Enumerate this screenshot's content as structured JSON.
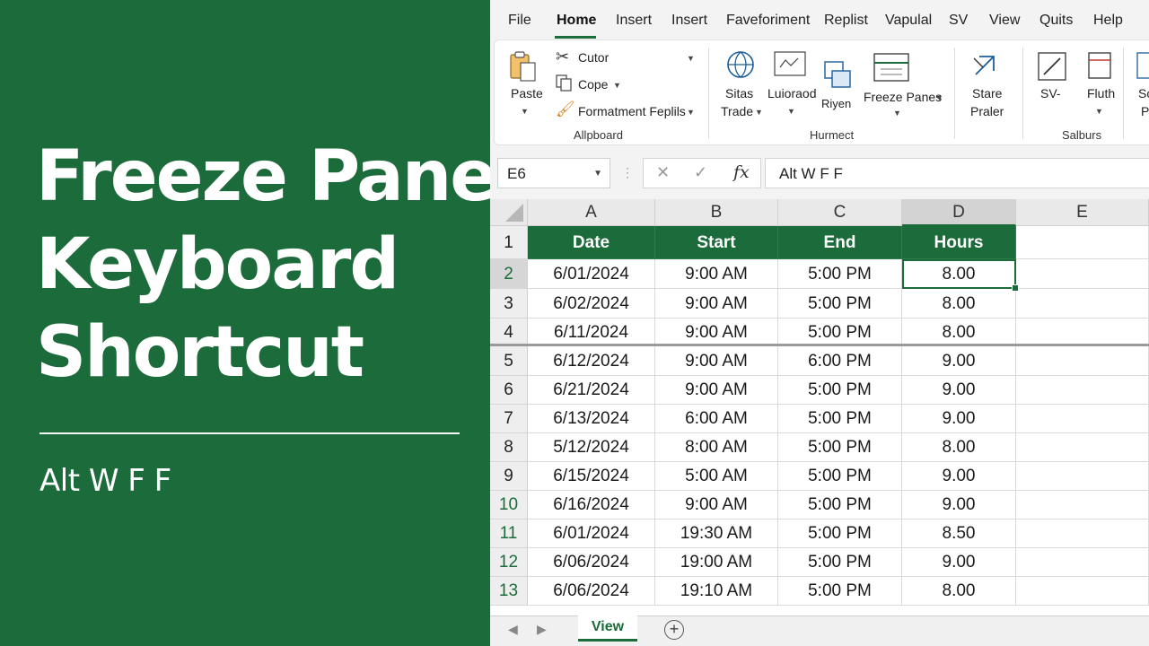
{
  "banner": {
    "title_lines": [
      "Freeze Panes",
      "Keyboard",
      "Shortcut"
    ],
    "shortcut": "Alt W F F"
  },
  "menu": {
    "items": [
      "File",
      "Home",
      "Insert",
      "Insert",
      "Faveforiment",
      "Replist",
      "Vapulal",
      "SV",
      "View",
      "Quits",
      "Help"
    ],
    "active": "Home"
  },
  "ribbon": {
    "clipboard": {
      "paste": "Paste",
      "cut": "Cutor",
      "copy": "Cope",
      "format": "Formatment Feplils",
      "group_label": "Allpboard"
    },
    "format": {
      "sitas_line1": "Sitas",
      "sitas_line2": "Trade",
      "luioraod": "Luioraod",
      "riyen": "Riyen",
      "freeze_panes": "Freeze Panes",
      "group_label": "Hurmect"
    },
    "stare_line1": "Stare",
    "stare_line2": "Praler",
    "sv": "SV-",
    "fluth": "Fluth",
    "sc_line1": "Sc",
    "sc_line2": "P",
    "salburs_label": "Salburs"
  },
  "formula_bar": {
    "name_box": "E6",
    "cancel": "✕",
    "enter": "✓",
    "fx": "fx",
    "formula": "Alt W F F"
  },
  "grid": {
    "columns": [
      "A",
      "B",
      "C",
      "D",
      "E"
    ],
    "selected_column": "D",
    "header_row": [
      "Date",
      "Start",
      "End",
      "Hours"
    ],
    "row_numbers": [
      "1",
      "2",
      "3",
      "4",
      "5",
      "6",
      "7",
      "8",
      "9",
      "10",
      "11",
      "12",
      "13"
    ],
    "rows": [
      [
        "6/01/2024",
        "9:00 AM",
        "5:00 PM",
        "8.00"
      ],
      [
        "6/02/2024",
        "9:00 AM",
        "5:00 PM",
        "8.00"
      ],
      [
        "6/11/2024",
        "9:00 AM",
        "5:00 PM",
        "8.00"
      ],
      [
        "6/12/2024",
        "9:00 AM",
        "6:00 PM",
        "9.00"
      ],
      [
        "6/21/2024",
        "9:00 AM",
        "5:00 PM",
        "9.00"
      ],
      [
        "6/13/2024",
        "6:00 AM",
        "5:00 PM",
        "9.00"
      ],
      [
        "5/12/2024",
        "8:00 AM",
        "5:00 PM",
        "8.00"
      ],
      [
        "6/15/2024",
        "5:00 AM",
        "5:00 PM",
        "9.00"
      ],
      [
        "6/16/2024",
        "9:00 AM",
        "5:00 PM",
        "9.00"
      ],
      [
        "6/01/2024",
        "19:30 AM",
        "5:00 PM",
        "8.50"
      ],
      [
        "6/06/2024",
        "19:00 AM",
        "5:00 PM",
        "9.00"
      ],
      [
        "6/06/2024",
        "19:10 AM",
        "5:00 PM",
        "8.00"
      ]
    ]
  },
  "sheet_tabs": {
    "prev": "◀",
    "next": "▶",
    "active_tab": "View",
    "add": "+"
  },
  "colors": {
    "brand_green": "#1c6b3a",
    "header_fill": "#1c6b3a"
  }
}
